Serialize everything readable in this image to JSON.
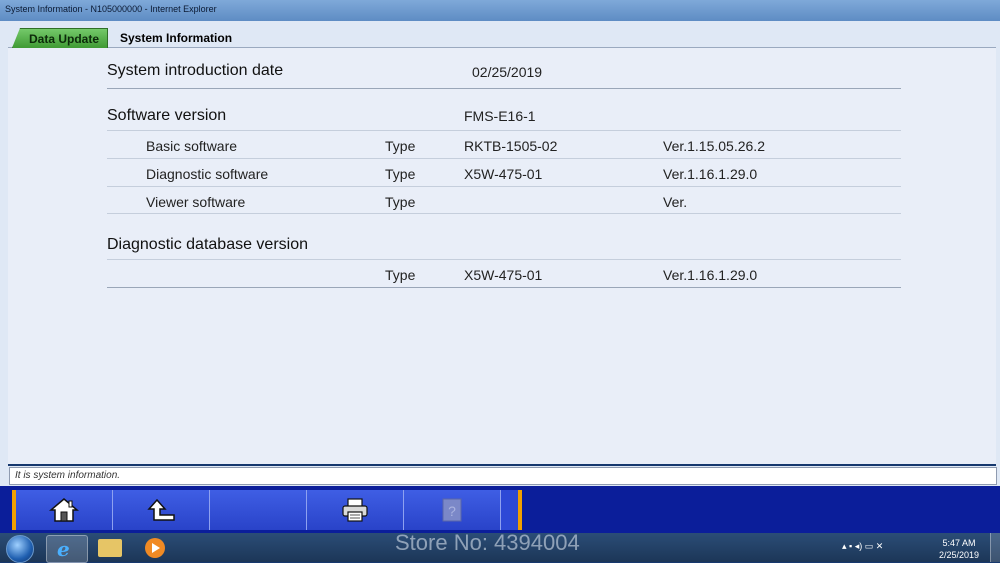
{
  "window": {
    "title": "System Information - N105000000 - Internet Explorer"
  },
  "tabs": {
    "data_update": "Data Update",
    "system_information": "System Information"
  },
  "sections": {
    "intro": {
      "label": "System introduction date",
      "value": "02/25/2019"
    },
    "software": {
      "label": "Software version",
      "value": "FMS-E16-1",
      "rows": [
        {
          "name": "Basic software",
          "type": "Type",
          "code": "RKTB-1505-02",
          "version": "Ver.1.15.05.26.2"
        },
        {
          "name": "Diagnostic software",
          "type": "Type",
          "code": "X5W-475-01",
          "version": "Ver.1.16.1.29.0"
        },
        {
          "name": "Viewer software",
          "type": "Type",
          "code": "",
          "version": "Ver."
        }
      ]
    },
    "database": {
      "label": "Diagnostic database version",
      "row": {
        "type": "Type",
        "code": "X5W-475-01",
        "version": "Ver.1.16.1.29.0"
      }
    }
  },
  "status": {
    "text": "It is system information."
  },
  "toolbar": {
    "buttons": [
      "home-icon",
      "back-icon",
      "empty",
      "printer-icon",
      "help-icon"
    ]
  },
  "taskbar": {
    "watermark": "Store No: 4394004",
    "time": "5:47 AM",
    "date": "2/25/2019"
  },
  "colors": {
    "toolbar_blue": "#2d49d6",
    "accent_orange": "#f2a000",
    "tab_green": "#3f9a34",
    "content_bg": "#e9eef8"
  }
}
